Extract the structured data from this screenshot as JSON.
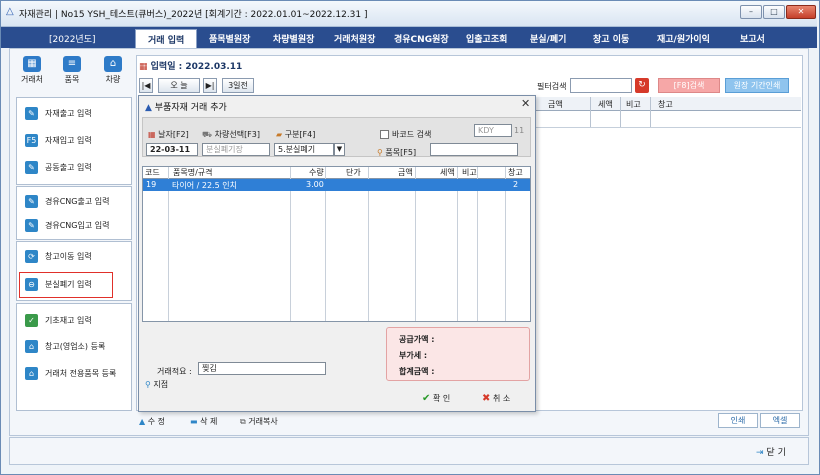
{
  "window": {
    "title": "자재관리 | No15 YSH_테스트(큐버스)_2022년 [회계기간 : 2022.01.01~2022.12.31 ]",
    "minimize": "–",
    "maximize": "□",
    "close": "✕"
  },
  "menubar": {
    "year": "[2022년도]",
    "items": [
      "거래 입력",
      "품목별원장",
      "차량별원장",
      "거래처원장",
      "경유CNG원장",
      "입출고조회",
      "분실/폐기",
      "창고 이동",
      "재고/원가이익",
      "보고서"
    ]
  },
  "toolbar": {
    "items": [
      {
        "label": "거래처",
        "icon": "building-icon"
      },
      {
        "label": "품목",
        "icon": "document-icon"
      },
      {
        "label": "차량",
        "icon": "home-icon"
      }
    ]
  },
  "sidebar": {
    "group1": [
      "자재출고 입력",
      "자재입고 입력",
      "공동출고 입력"
    ],
    "group2": [
      "경유CNG출고 입력",
      "경유CNG입고 입력"
    ],
    "group3": [
      "창고이동 입력",
      "분실폐기 입력"
    ],
    "group4": [
      "기초재고 입력",
      "창고(영업소) 등록",
      "거래처 전용품목 등록"
    ],
    "f5_badge": "F5"
  },
  "main": {
    "input_date_label": "입력일 : 2022.03.11",
    "nav": {
      "first": "|◀",
      "today": "오 늘",
      "last": "▶|",
      "three_days_ago": "3일전"
    },
    "filter_label": "필터검색",
    "filter_value": "",
    "f8_button": "[F8]검색",
    "ledger_print_button": "원장 기간인쇄",
    "grid_headers": [
      "금액",
      "세액",
      "비고",
      "창고"
    ]
  },
  "dialog": {
    "title": "부품자재 거래 추가",
    "date_label": "날자[F2]",
    "vehicle_label": "차량선택[F3]",
    "category_label": "구분[F4]",
    "barcode_label": "바코드 검색",
    "kdy_code": "KDY",
    "kdy_num": "11",
    "date_value": "22-03-11",
    "vehicle_placeholder": "분실폐기장",
    "category_value": "5.분실폐기",
    "item_label": "품목[F5]",
    "item_value": "",
    "table_headers": [
      "코드",
      "품목명/규격",
      "수량",
      "단가",
      "금액",
      "세액",
      "비고",
      "창고"
    ],
    "rows": [
      {
        "code": "19",
        "name": "타이어 / 22.5 인치",
        "qty": "3.00",
        "price": "",
        "amount": "",
        "tax": "",
        "note": "",
        "warehouse": "2"
      }
    ],
    "summary": {
      "supply": "공급가액 :",
      "vat": "부가세 :",
      "total": "합계금액 :"
    },
    "memo_label": "거래적요 :",
    "memo_value": "찢김",
    "point_label": "지점",
    "ok": "확 인",
    "cancel": "취 소"
  },
  "bottom": {
    "edit": "수 정",
    "delete": "삭 제",
    "copy": "거래복사",
    "print": "인쇄",
    "excel": "엑셀",
    "close": "닫 기"
  }
}
